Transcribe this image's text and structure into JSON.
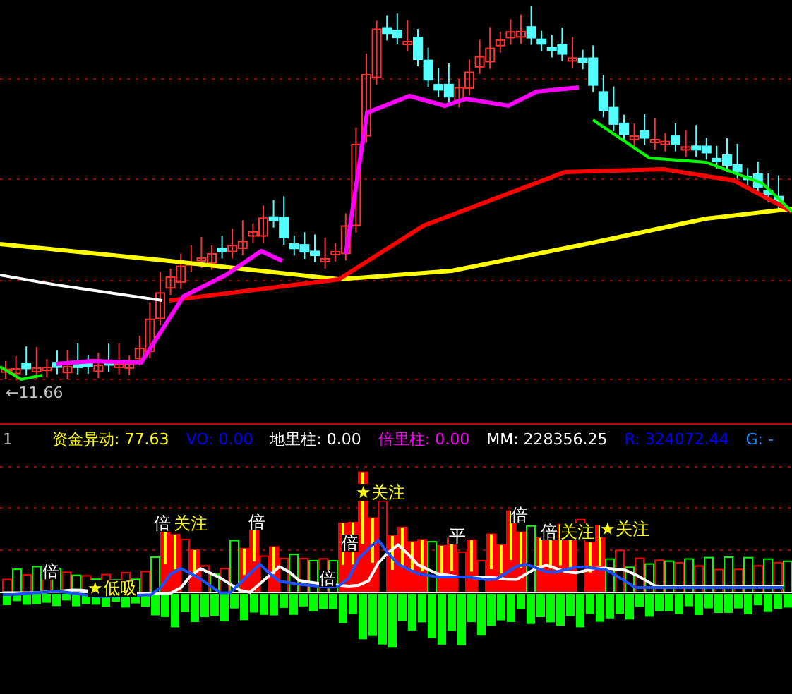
{
  "price_panel": {
    "low_price_label": "←11.66"
  },
  "indicator_bar": {
    "row_number": "1",
    "items": [
      {
        "label": "资金异动: 77.63",
        "color": "#ffff00"
      },
      {
        "label": "VO: 0.00",
        "color": "#0000ff"
      },
      {
        "label": "地里柱: 0.00",
        "color": "#ffffff"
      },
      {
        "label": "倍里柱: 0.00",
        "color": "#ff00ff"
      },
      {
        "label": "MM: 228356.25",
        "color": "#ffffff"
      },
      {
        "label": "R: 324072.44",
        "color": "#0000ff"
      },
      {
        "label": "G: -",
        "color": "#1e90ff"
      }
    ]
  },
  "indicator_panel": {
    "annotations": [
      {
        "text": "倍",
        "kind": "mark"
      },
      {
        "text": "★低吸",
        "kind": "watch"
      },
      {
        "text": "倍",
        "kind": "mark"
      },
      {
        "text": "关注",
        "kind": "watch"
      },
      {
        "text": "倍",
        "kind": "mark"
      },
      {
        "text": "倍",
        "kind": "mark"
      },
      {
        "text": "倍",
        "kind": "mark"
      },
      {
        "text": "★关注",
        "kind": "watch"
      },
      {
        "text": "平",
        "kind": "mark"
      },
      {
        "text": "倍",
        "kind": "mark"
      },
      {
        "text": "倍",
        "kind": "mark"
      },
      {
        "text": "关注",
        "kind": "watch"
      },
      {
        "text": "★关注",
        "kind": "watch"
      }
    ]
  }
}
